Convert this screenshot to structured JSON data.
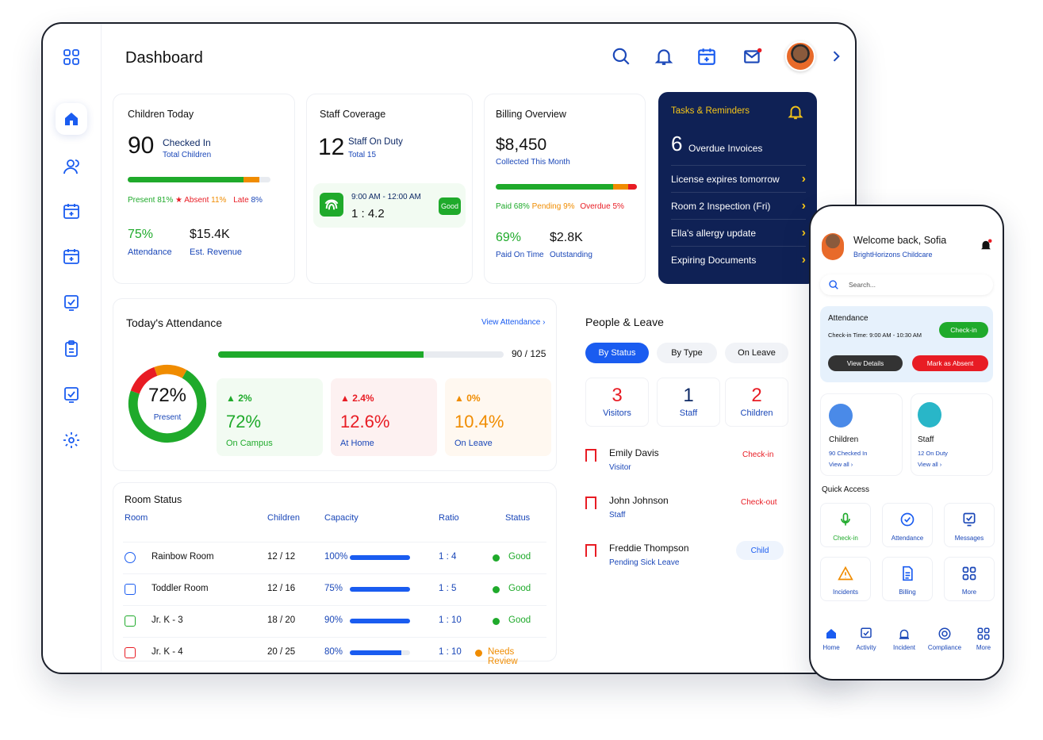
{
  "header": {
    "title": "Dashboard"
  },
  "colors": {
    "primary": "#1a5cf0",
    "navy": "#0f2155",
    "green": "#1faa2b",
    "orange": "#f08c00",
    "red": "#e81c24"
  },
  "sidebar": {
    "items": [
      {
        "icon": "grid-icon"
      },
      {
        "icon": "home-icon"
      },
      {
        "icon": "users-icon"
      },
      {
        "icon": "calendar-plus-icon"
      },
      {
        "icon": "calendar-add-icon"
      },
      {
        "icon": "checklist-icon"
      },
      {
        "icon": "clipboard-icon"
      },
      {
        "icon": "task-check-icon"
      },
      {
        "icon": "gear-icon"
      }
    ]
  },
  "children_today": {
    "title": "Children Today",
    "count": "90",
    "checked_in": "Checked In",
    "total": "Total Children",
    "present": "Present 81%",
    "present_pct": 81,
    "absent": "Absent",
    "absent_val": "11%",
    "absent_pct": 11,
    "late": "Late",
    "late_val": "8%",
    "late_pct": 8,
    "attendance_val": "75%",
    "attendance_lbl": "Attendance",
    "revenue_val": "$15.4K",
    "revenue_lbl": "Est. Revenue"
  },
  "staff_coverage": {
    "title": "Staff Coverage",
    "count": "12",
    "on_duty": "Staff On Duty",
    "total": "Total 15",
    "time": "9:00 AM - 12:00 AM",
    "ratio": "1 : 4.2",
    "badge": "Good"
  },
  "billing": {
    "title": "Billing Overview",
    "amount": "$8,450",
    "collected": "Collected This Month",
    "paid": "Paid 68%",
    "paid_pct": 68,
    "pending": "Pending 9%",
    "pending_pct": 9,
    "overdue": "Overdue 5%",
    "overdue_pct": 5,
    "on_time_val": "69%",
    "on_time_lbl": "Paid On Time",
    "outstanding_val": "$2.8K",
    "outstanding_lbl": "Outstanding"
  },
  "tasks": {
    "title": "Tasks & Reminders",
    "count": "6",
    "count_lbl": "Overdue Invoices",
    "items": [
      "License expires tomorrow",
      "Room 2 Inspection (Fri)",
      "Ella's allergy update",
      "Expiring Documents"
    ]
  },
  "attendance": {
    "title": "Today's Attendance",
    "link": "View Attendance",
    "progress": "90 / 125",
    "progress_frac": 0.72,
    "donut_val": "72%",
    "donut_lbl": "Present",
    "stats": [
      {
        "trend": "2%",
        "value": "72%",
        "label": "On Campus"
      },
      {
        "trend": "2.4%",
        "value": "12.6%",
        "label": "At Home"
      },
      {
        "trend": "0%",
        "value": "10.4%",
        "label": "On Leave"
      }
    ]
  },
  "people": {
    "title": "People & Leave",
    "tabs": [
      "By Status",
      "By Type",
      "On Leave"
    ],
    "counts": [
      {
        "n": "3",
        "l": "Visitors"
      },
      {
        "n": "1",
        "l": "Staff"
      },
      {
        "n": "2",
        "l": "Children"
      }
    ],
    "rows": [
      {
        "name": "Emily Davis",
        "role": "Visitor",
        "status": "Check-in"
      },
      {
        "name": "John Johnson",
        "role": "Staff",
        "status": "Check-out"
      },
      {
        "name": "Freddie Thompson",
        "role": "Pending Sick Leave",
        "status": "Child"
      }
    ]
  },
  "rooms": {
    "title": "Room Status",
    "headers": [
      "Room",
      "Children",
      "Capacity",
      "Ratio",
      "Status"
    ],
    "rows": [
      {
        "name": "Rainbow Room",
        "children": "12 / 12",
        "capacity": "100%",
        "cap_frac": 1.0,
        "ratio": "1 : 4",
        "status": "Good"
      },
      {
        "name": "Toddler Room",
        "children": "12 / 16",
        "capacity": "75%",
        "cap_frac": 1.0,
        "ratio": "1 : 5",
        "status": "Good"
      },
      {
        "name": "Jr. K - 3",
        "children": "18 / 20",
        "capacity": "90%",
        "cap_frac": 1.0,
        "ratio": "1 : 10",
        "status": "Good"
      },
      {
        "name": "Jr. K - 4",
        "children": "20 / 25",
        "capacity": "80%",
        "cap_frac": 0.85,
        "ratio": "1 : 10",
        "status": "Needs Review"
      }
    ]
  },
  "phone": {
    "welcome": "Welcome back, Sofia",
    "org": "BrightHorizons Childcare",
    "search_placeholder": "Search...",
    "att_title": "Attendance",
    "checkin_time": "Check-in Time: 9:00 AM - 10:30 AM",
    "checkin_btn": "Check-in",
    "details_btn": "View Details",
    "absent_btn": "Mark as Absent",
    "children": {
      "title": "Children",
      "sub": "90 Checked In",
      "link": "View all"
    },
    "staff": {
      "title": "Staff",
      "sub": "12 On Duty",
      "link": "View all"
    },
    "quick": "Quick Access",
    "quick_items": [
      "Check-in",
      "Attendance",
      "Messages",
      "Incidents",
      "Billing",
      "More"
    ],
    "nav": [
      "Home",
      "Activity",
      "Incident",
      "Compliance",
      "More"
    ]
  }
}
